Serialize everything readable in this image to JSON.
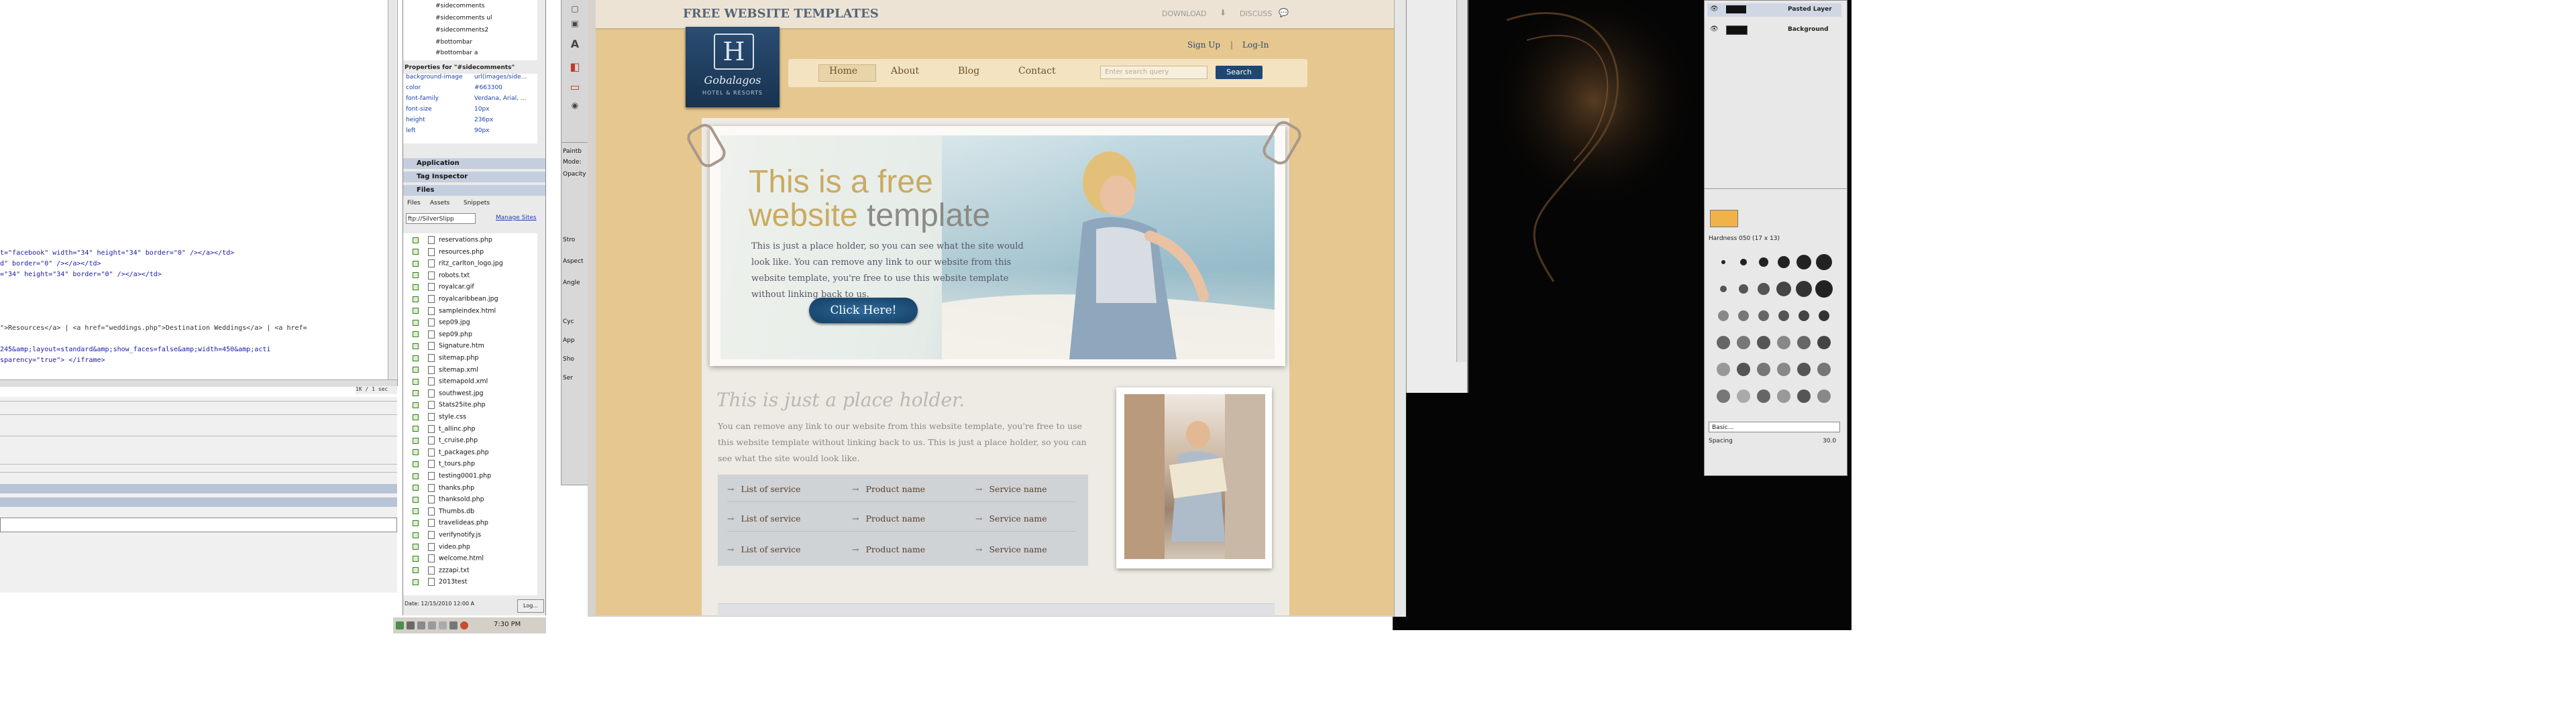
{
  "code": {
    "lines": [
      {
        "text": "t=\"facebook\" width=\"34\" height=\"34\" border=\"0\" /></a></td>",
        "color": "blue"
      },
      {
        "text": "d\" border=\"0\" /></a></td>",
        "color": "blue"
      },
      {
        "text": "=\"34\" height=\"34\" border=\"0\" /></a></td>",
        "color": "blue"
      },
      {
        "text": "\">Resources</a> | <a href=\"weddings.php\">Destination Weddings</a> | <a href=",
        "color": "black"
      },
      {
        "text": "245&amp;layout=standard&amp;show_faces=false&amp;width=450&amp;acti",
        "color": "blue"
      },
      {
        "text": "sparency=\"true\"> </iframe>",
        "color": "blue"
      }
    ],
    "status": "1K / 1 sec"
  },
  "dw": {
    "css_rules": [
      "#sidecomments",
      "#sidecomments ul",
      "#sidecomments2",
      "#bottombar",
      "#bottombar a"
    ],
    "properties_title": "Properties for \"#sidecomments\"",
    "properties": [
      {
        "name": "background-image",
        "value": "url(images/side..."
      },
      {
        "name": "color",
        "value": "#663300"
      },
      {
        "name": "font-family",
        "value": "Verdana, Arial, ..."
      },
      {
        "name": "font-size",
        "value": "10px"
      },
      {
        "name": "height",
        "value": "236px"
      },
      {
        "name": "left",
        "value": "90px"
      }
    ],
    "panel_headers": [
      "Application",
      "Tag Inspector",
      "Files"
    ],
    "files_tabs": [
      "Files",
      "Assets",
      "Snippets"
    ],
    "site_select": "ftp://SilverSlipp",
    "manage_sites": "Manage Sites",
    "files": [
      "reservations.php",
      "resources.php",
      "ritz_carlton_logo.jpg",
      "robots.txt",
      "royalcar.gif",
      "royalcaribbean.jpg",
      "sampleindex.html",
      "sep09.jpg",
      "sep09.php",
      "Signature.htm",
      "sitemap.php",
      "sitemap.xml",
      "sitemapold.xml",
      "southwest.jpg",
      "Stats25ite.php",
      "style.css",
      "t_allinc.php",
      "t_cruise.php",
      "t_packages.php",
      "t_tours.php",
      "testing0001.php",
      "thanks.php",
      "thanksold.php",
      "Thumbs.db",
      "travelideas.php",
      "verifynotify.js",
      "video.php",
      "welcome.html",
      "zzzapi.txt",
      "2013test"
    ],
    "date_status": "Date: 12/15/2010 12:00 A",
    "log_button": "Log..."
  },
  "taskbar": {
    "clock": "7:30 PM"
  },
  "ps": {
    "tools_glyphs": [
      "T",
      "A",
      "◧",
      "▭"
    ],
    "paint_options": [
      "Paintb",
      "Mode:",
      "Opacity",
      "Stro",
      "Aspect",
      "Angle",
      "Cyc",
      "App",
      "Sho",
      "Ser"
    ]
  },
  "layers": {
    "items": [
      "Pasted Layer",
      "Background"
    ]
  },
  "brushes": {
    "preset_name": "Hardness 050 (17 x 13)",
    "footer_select": "Basic...",
    "spacing_label": "Spacing",
    "spacing_value": "30.0"
  },
  "site": {
    "brand": "FREE WEBSITE TEMPLATES",
    "download": "DOWNLOAD",
    "discuss": "DISCUSS",
    "sign_up": "Sign Up",
    "separator": "|",
    "log_in": "Log-In",
    "logo_text": "Gobalagos",
    "logo_sub": "HOTEL & RESORTS",
    "nav": [
      "Home",
      "About",
      "Blog",
      "Contact"
    ],
    "search_placeholder": "Enter search query",
    "search_button": "Search",
    "hero_line1": "This is a free",
    "hero_line2_a": "website",
    "hero_line2_b": "template",
    "hero_text": "This is just a place holder, so you can see what the site would look like. You can remove any link to our website from this website template, you're free to use this website template without linking back to us.",
    "hero_button": "Click Here!",
    "placeholder_title": "This is just a place holder.",
    "placeholder_text": "You can remove any link to our website from this website template, you're free to use this website template without linking back to us. This is just a place holder, so you can see what the site would look like.",
    "list": [
      [
        "List of service",
        "Product name",
        "Service name"
      ],
      [
        "List of service",
        "Product name",
        "Service name"
      ],
      [
        "List of service",
        "Product name",
        "Service name"
      ]
    ]
  },
  "colors": {
    "site_tan": "#e6c78f",
    "site_blue": "#1f4773",
    "hero_gold": "#c9ab62",
    "code_blue": "#1a1aa8"
  }
}
